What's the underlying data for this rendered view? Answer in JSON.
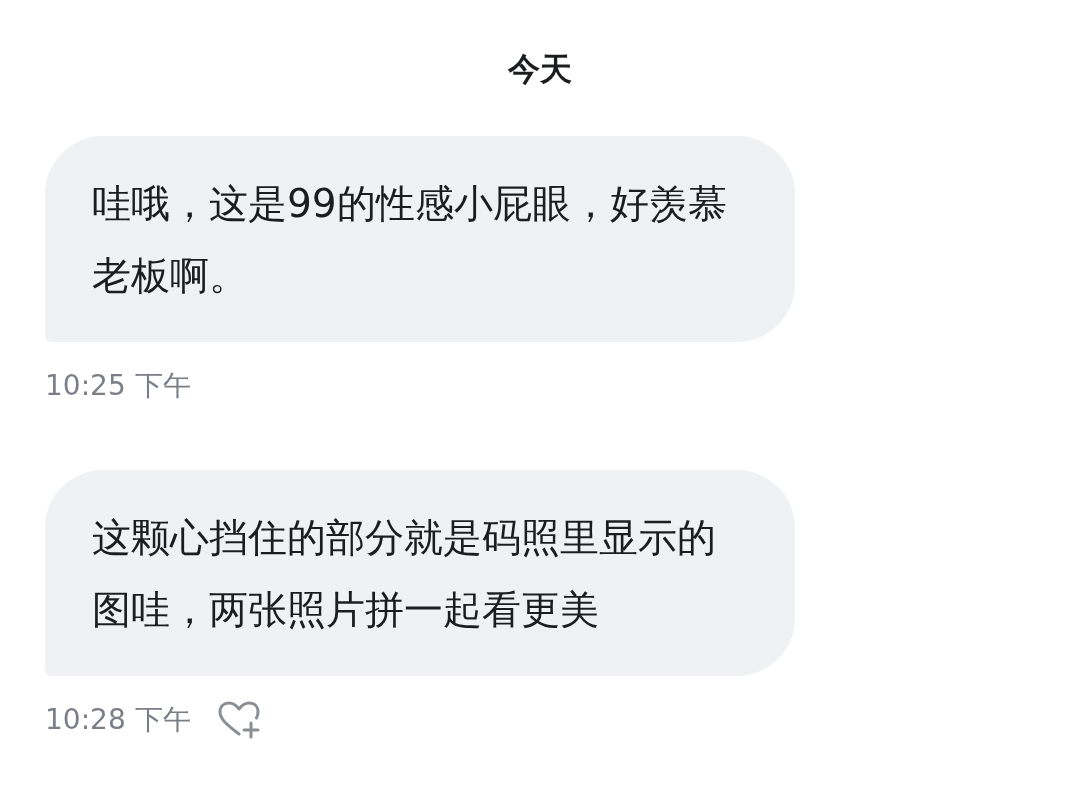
{
  "date_header": "今天",
  "messages": [
    {
      "text": "哇哦，这是99的性感小屁眼，好羡慕老板啊。",
      "time": "10:25 下午",
      "react_icon": false
    },
    {
      "text": "这颗心挡住的部分就是码照里显示的图哇，两张照片拼一起看更美",
      "time": "10:28 下午",
      "react_icon": true
    }
  ]
}
